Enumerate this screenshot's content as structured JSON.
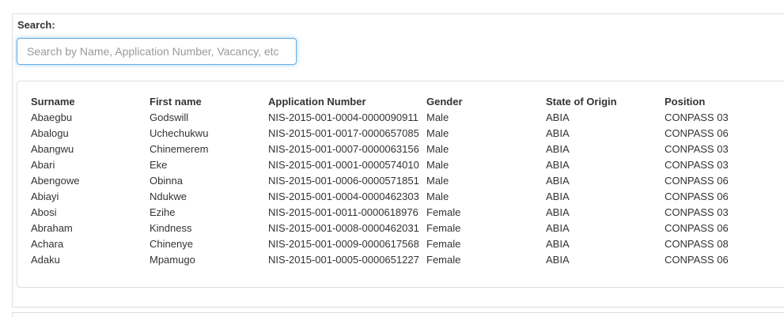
{
  "search": {
    "label": "Search:",
    "placeholder": "Search by Name, Application Number, Vacancy, etc",
    "value": ""
  },
  "table": {
    "headers": {
      "surname": "Surname",
      "first_name": "First name",
      "application_number": "Application Number",
      "gender": "Gender",
      "state_of_origin": "State of Origin",
      "position": "Position"
    },
    "rows": [
      {
        "surname": "Abaegbu",
        "first_name": "Godswill",
        "application_number": "NIS-2015-001-0004-0000090911",
        "gender": "Male",
        "state_of_origin": "ABIA",
        "position": "CONPASS 03"
      },
      {
        "surname": "Abalogu",
        "first_name": "Uchechukwu",
        "application_number": "NIS-2015-001-0017-0000657085",
        "gender": "Male",
        "state_of_origin": "ABIA",
        "position": "CONPASS 06"
      },
      {
        "surname": "Abangwu",
        "first_name": "Chinemerem",
        "application_number": "NIS-2015-001-0007-0000063156",
        "gender": "Male",
        "state_of_origin": "ABIA",
        "position": "CONPASS 03"
      },
      {
        "surname": "Abari",
        "first_name": "Eke",
        "application_number": "NIS-2015-001-0001-0000574010",
        "gender": "Male",
        "state_of_origin": "ABIA",
        "position": "CONPASS 03"
      },
      {
        "surname": "Abengowe",
        "first_name": "Obinna",
        "application_number": "NIS-2015-001-0006-0000571851",
        "gender": "Male",
        "state_of_origin": "ABIA",
        "position": "CONPASS 06"
      },
      {
        "surname": "Abiayi",
        "first_name": "Ndukwe",
        "application_number": "NIS-2015-001-0004-0000462303",
        "gender": "Male",
        "state_of_origin": "ABIA",
        "position": "CONPASS 06"
      },
      {
        "surname": "Abosi",
        "first_name": "Ezihe",
        "application_number": "NIS-2015-001-0011-0000618976",
        "gender": "Female",
        "state_of_origin": "ABIA",
        "position": "CONPASS 03"
      },
      {
        "surname": "Abraham",
        "first_name": "Kindness",
        "application_number": "NIS-2015-001-0008-0000462031",
        "gender": "Female",
        "state_of_origin": "ABIA",
        "position": "CONPASS 06"
      },
      {
        "surname": "Achara",
        "first_name": "Chinenye",
        "application_number": "NIS-2015-001-0009-0000617568",
        "gender": "Female",
        "state_of_origin": "ABIA",
        "position": "CONPASS 08"
      },
      {
        "surname": "Adaku",
        "first_name": "Mpamugo",
        "application_number": "NIS-2015-001-0005-0000651227",
        "gender": "Female",
        "state_of_origin": "ABIA",
        "position": "CONPASS 06"
      }
    ]
  },
  "colors": {
    "focus_border": "#66afe9",
    "text": "#333333",
    "border": "#dddddd"
  }
}
